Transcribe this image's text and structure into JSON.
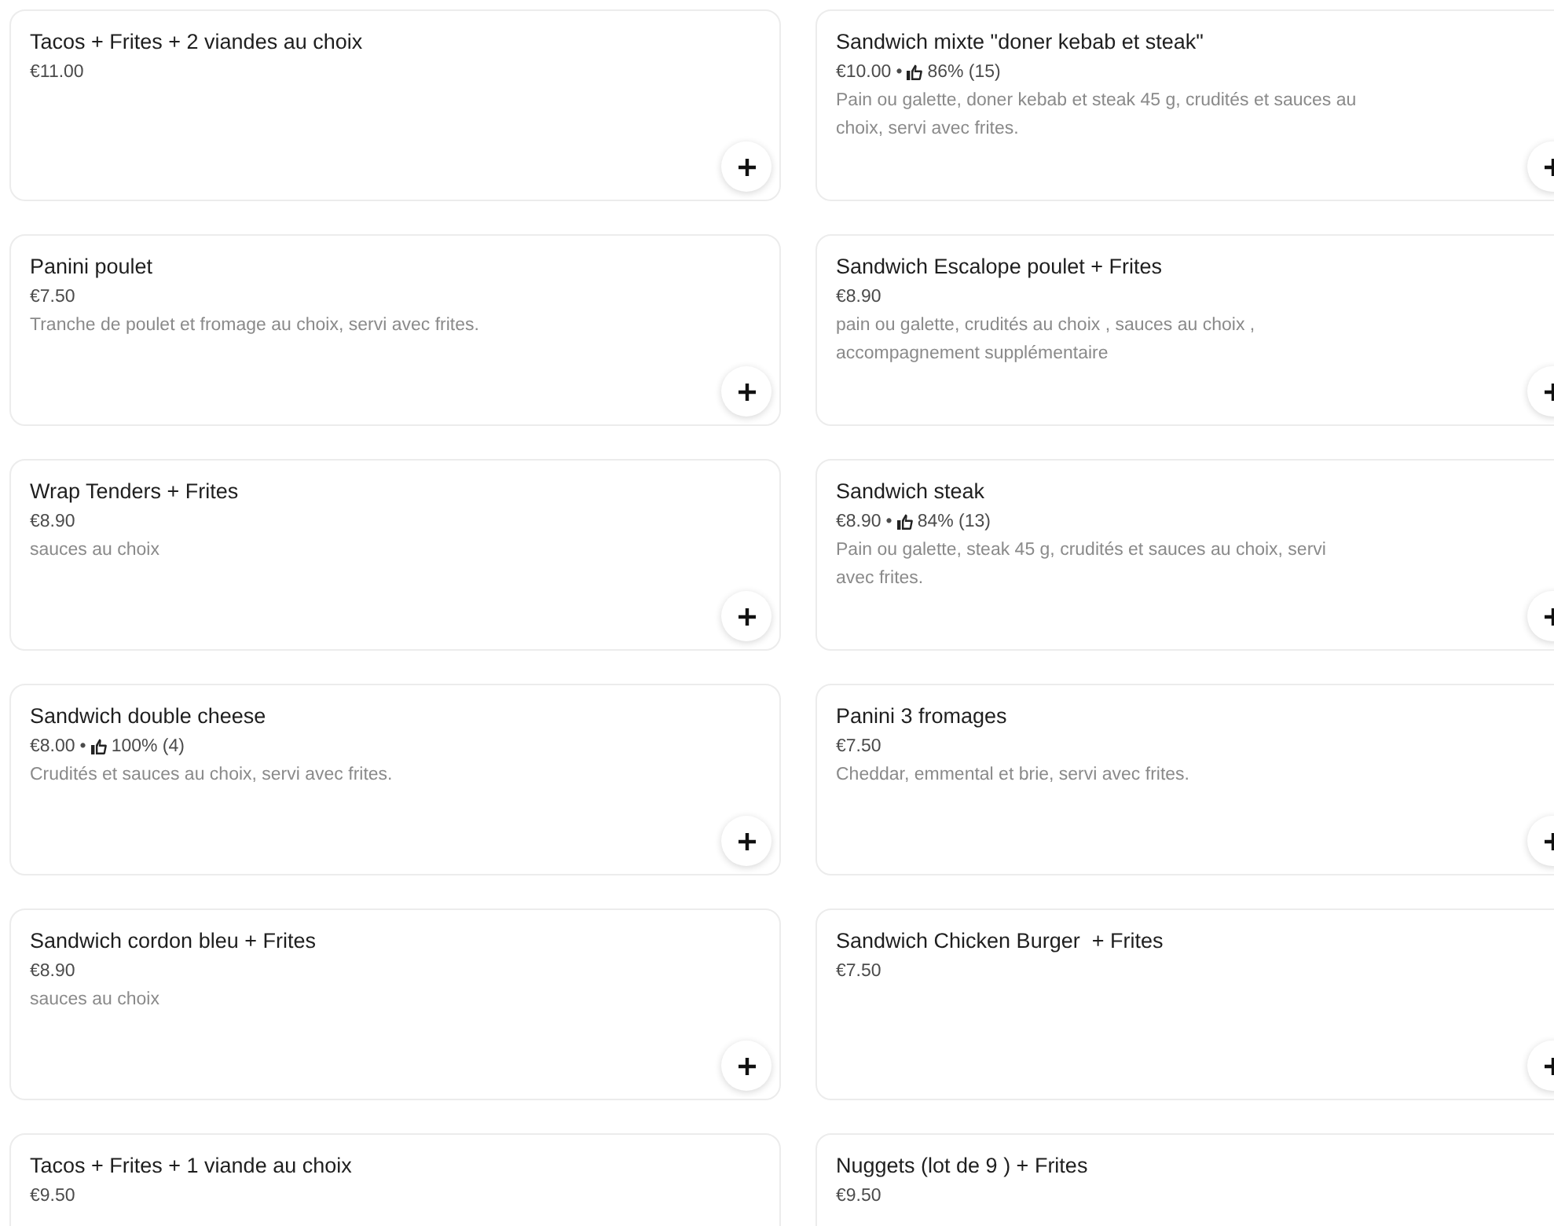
{
  "menu_items": [
    {
      "name": "Tacos + Frites + 2 viandes au choix",
      "price": "€11.00"
    },
    {
      "name": "Sandwich mixte \"doner kebab et steak\"",
      "price": "€10.00",
      "separator": "•",
      "rating": "86% (15)",
      "description": "Pain ou galette, doner kebab et steak 45 g, crudités et sauces au choix, servi avec frites."
    },
    {
      "name": "Panini poulet",
      "price": "€7.50",
      "description": "Tranche de poulet et fromage au choix, servi avec frites."
    },
    {
      "name": "Sandwich Escalope poulet + Frites",
      "price": "€8.90",
      "description": "pain ou galette, crudités au choix , sauces au choix , accompagnement supplémentaire"
    },
    {
      "name": "Wrap Tenders + Frites",
      "price": "€8.90",
      "description": "sauces au choix"
    },
    {
      "name": "Sandwich steak",
      "price": "€8.90",
      "separator": "•",
      "rating": "84% (13)",
      "description": "Pain ou galette, steak 45 g, crudités et sauces au choix, servi avec frites."
    },
    {
      "name": "Sandwich double cheese",
      "price": "€8.00",
      "separator": "•",
      "rating": "100% (4)",
      "description": "Crudités et sauces au choix, servi avec frites."
    },
    {
      "name": "Panini 3 fromages",
      "price": "€7.50",
      "description": "Cheddar, emmental et brie, servi avec frites."
    },
    {
      "name": "Sandwich cordon bleu + Frites",
      "price": "€8.90",
      "description": "sauces au choix"
    },
    {
      "name": "Sandwich Chicken Burger  + Frites",
      "price": "€7.50"
    },
    {
      "name": "Tacos + Frites + 1 viande au choix",
      "price": "€9.50"
    },
    {
      "name": "Nuggets (lot de 9 ) + Frites",
      "price": "€9.50"
    }
  ]
}
